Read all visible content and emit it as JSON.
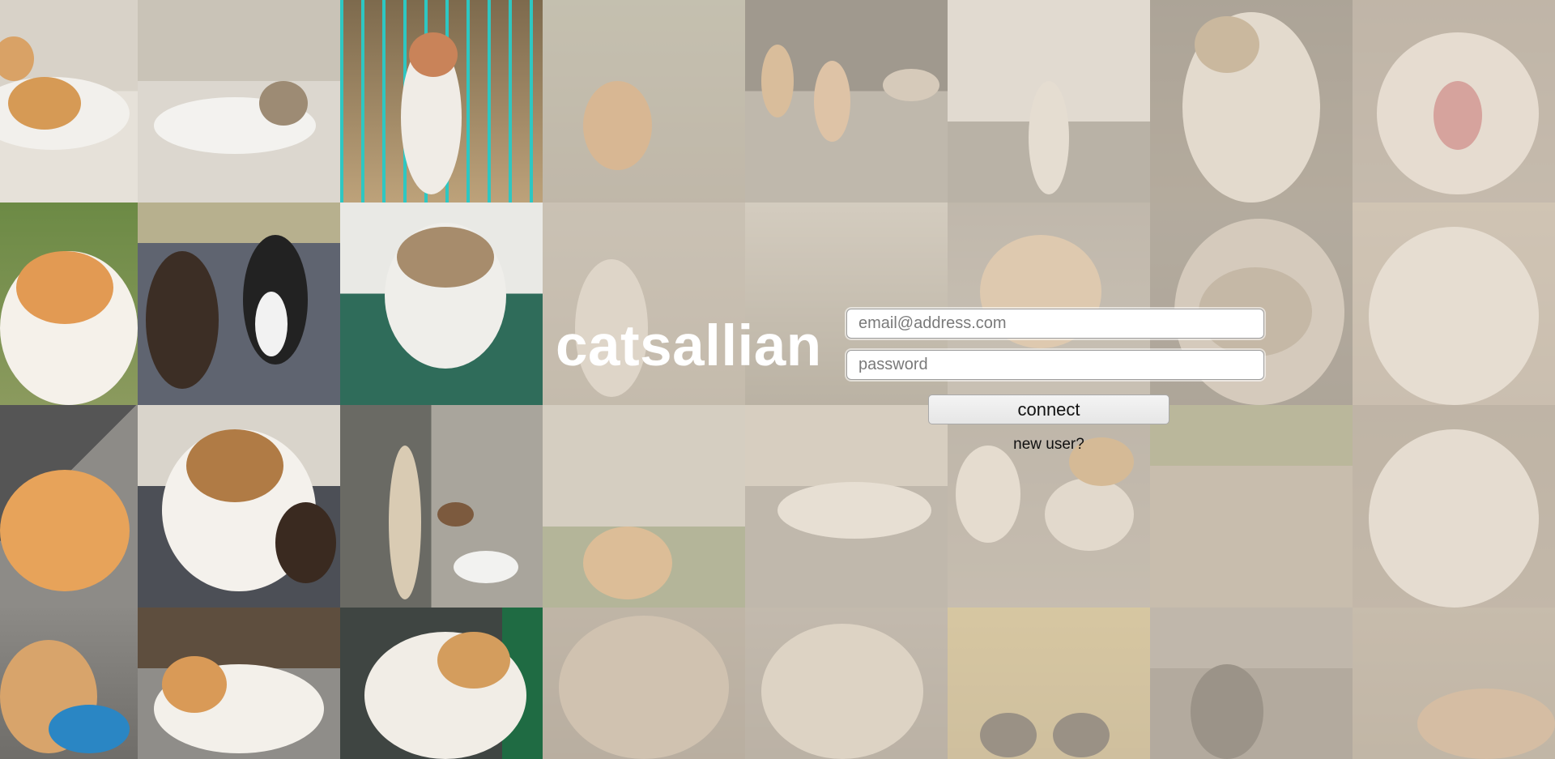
{
  "brand": {
    "name": "catsallian"
  },
  "login_form": {
    "email": {
      "placeholder": "email@address.com",
      "value": ""
    },
    "password": {
      "placeholder": "password",
      "value": ""
    },
    "connect_label": "connect",
    "new_user_label": "new user?"
  },
  "background": {
    "description_tiles": [
      "cat-photo",
      "cat-photo",
      "cat-photo",
      "cat-photo",
      "cat-photo",
      "cat-photo",
      "cat-photo",
      "cat-photo",
      "cat-photo",
      "cat-photo",
      "cat-photo",
      "cat-photo",
      "cat-photo",
      "cat-photo",
      "cat-photo",
      "cat-photo",
      "cat-photo",
      "cat-photo",
      "cat-photo",
      "cat-photo",
      "cat-photo",
      "cat-photo",
      "cat-photo",
      "cat-photo",
      "cat-photo",
      "cat-photo",
      "cat-photo",
      "cat-photo",
      "cat-photo",
      "cat-photo",
      "cat-photo",
      "cat-photo"
    ],
    "overlay_color": "#ded4c4"
  }
}
